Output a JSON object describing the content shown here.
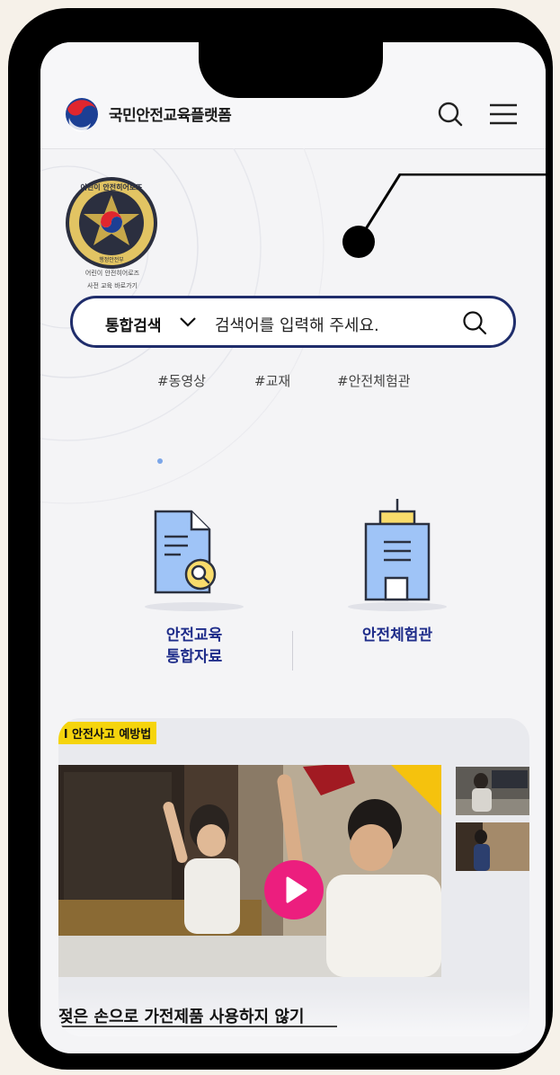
{
  "header": {
    "site_name": "국민안전교육플랫폼"
  },
  "badge": {
    "ring_top": "어린이 안전히어로즈",
    "ring_bottom": "행정안전부",
    "caption_line1": "어린이 안전히어로즈",
    "caption_line2": "사전 교육 바로가기"
  },
  "search": {
    "scope_label": "통합검색",
    "placeholder": "검색어를 입력해 주세요."
  },
  "tags": [
    "#동영상",
    "#교재",
    "#안전체험관"
  ],
  "quick_links": [
    {
      "line1": "안전교육",
      "line2": "통합자료"
    },
    {
      "line1": "안전체험관",
      "line2": ""
    }
  ],
  "video": {
    "category_tag": "l 안전사고 예방법",
    "title": "젖은 손으로 가전제품 사용하지 않기"
  },
  "icons": [
    "gov-logo-icon",
    "search-icon",
    "menu-icon",
    "chevron-down-icon",
    "document-search-icon",
    "building-icon",
    "play-icon"
  ],
  "colors": {
    "navy": "#1f2d6b",
    "label_blue": "#1f2d8a",
    "play_pink": "#ec1e7e",
    "tag_yellow": "#f5d40d",
    "icon_blue": "#9fc4f7",
    "icon_yellow": "#f9dc6b"
  }
}
